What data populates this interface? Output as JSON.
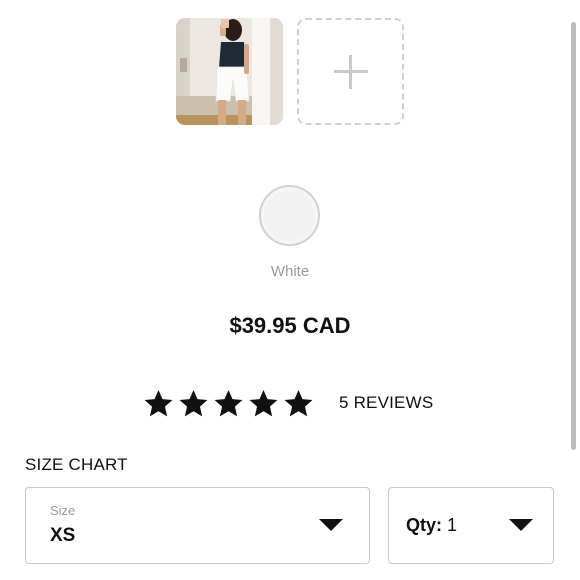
{
  "gallery": {
    "photo_alt": "Model wearing white biker shorts and black top",
    "add_icon": "plus-icon"
  },
  "color": {
    "name": "White",
    "swatch_hex": "#f2f2f2"
  },
  "price": "$39.95 CAD",
  "rating": {
    "stars": 5,
    "max_stars": 5,
    "reviews_label": "5 REVIEWS",
    "star_icon": "star-icon"
  },
  "size_chart_label": "SIZE CHART",
  "size_select": {
    "caption": "Size",
    "value": "XS",
    "icon": "caret-down-icon"
  },
  "qty_select": {
    "label": "Qty:",
    "value": "1",
    "icon": "caret-down-icon"
  },
  "colors": {
    "text": "#111111",
    "muted": "#9a9a9a",
    "border": "#c9c9c9",
    "dashed": "#cfcfcf"
  }
}
